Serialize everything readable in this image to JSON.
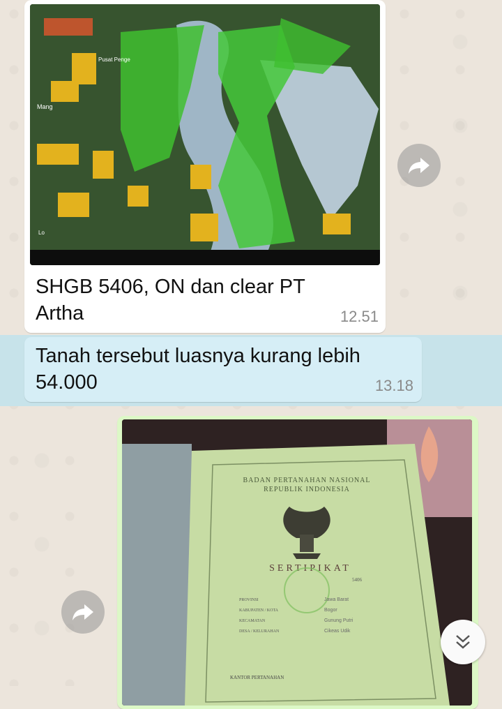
{
  "messages": [
    {
      "type": "image",
      "image_desc": "satellite-map-with-green-area",
      "map_labels": [
        "Pusat Penge",
        "Mang",
        "Lo"
      ],
      "caption": "SHGB 5406, ON dan clear  PT Artha",
      "time": "12.51"
    },
    {
      "type": "text",
      "text": "Tanah tersebut luasnya kurang lebih 54.000",
      "time": "13.18"
    },
    {
      "type": "image",
      "image_desc": "land-certificate-photo",
      "doc_header_line1": "BADAN PERTANAHAN NASIONAL",
      "doc_header_line2": "REPUBLIK INDONESIA",
      "doc_title": "SERTIPIKAT",
      "doc_fields": [
        "PROVINSI",
        "KABUPATEN / KOTA",
        "KECAMATAN",
        "DESA / KELURAHAN"
      ],
      "doc_values": [
        "Jawa Barat",
        "Bogor",
        "Gunung Putri",
        "Cikeas Udik"
      ],
      "doc_number": "5406",
      "doc_footer": "KANTOR PERTANAHAN"
    }
  ],
  "icons": {
    "forward": "forward-icon",
    "scroll": "double-chevron-down-icon"
  },
  "colors": {
    "wallpaper": "#ece5dc",
    "incoming": "#ffffff",
    "highlight": "#c7e3ea",
    "outgoing": "#dcf8c6"
  }
}
